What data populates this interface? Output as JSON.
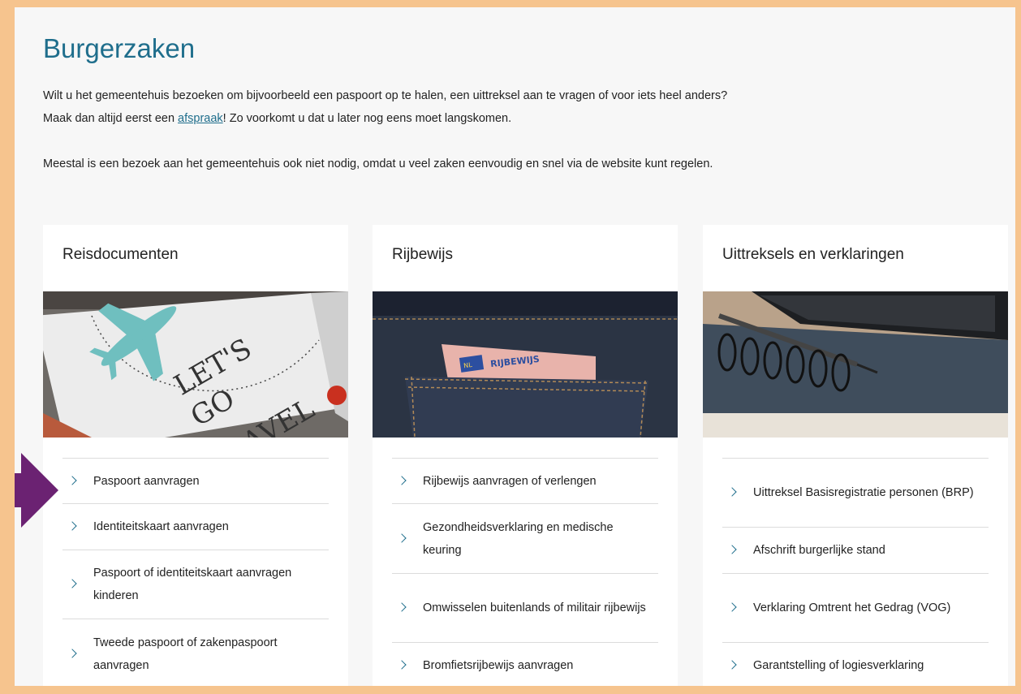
{
  "page": {
    "title": "Burgerzaken",
    "intro": {
      "p1_before": "Wilt u het gemeentehuis bezoeken om bijvoorbeeld een paspoort op te halen, een uittreksel aan te vragen of voor iets heel anders? Maak dan altijd eerst een ",
      "p1_link": "afspraak",
      "p1_after": "! Zo voorkomt u dat u later nog eens moet langskomen.",
      "p2": "Meestal is een bezoek aan het gemeentehuis ook niet nodig, omdat u veel zaken eenvoudig en snel via de website kunt regelen."
    }
  },
  "cards": [
    {
      "title": "Reisdocumenten",
      "image_text": [
        "LET'S",
        "GO",
        "TRAVEL"
      ],
      "links": [
        "Paspoort aanvragen",
        "Identiteitskaart aanvragen",
        "Paspoort of identiteitskaart aanvragen kinderen",
        "Tweede paspoort of zakenpaspoort aanvragen"
      ]
    },
    {
      "title": "Rijbewijs",
      "image_text": [
        "NL",
        "RIJBEWIJS"
      ],
      "links": [
        "Rijbewijs aanvragen of verlengen",
        "Gezondheidsverklaring en medische keuring",
        "Omwisselen buitenlands of militair rijbewijs",
        "Bromfietsrijbewijs aanvragen"
      ]
    },
    {
      "title": "Uittreksels en verklaringen",
      "links": [
        "Uittreksel Basisregistratie personen (BRP)",
        "Afschrift burgerlijke stand",
        "Verklaring Omtrent het Gedrag (VOG)",
        "Garantstelling of logiesverklaring"
      ]
    }
  ],
  "colors": {
    "frame": "#f6c48e",
    "heading": "#1f6e8c",
    "chevron": "#1f6e8c",
    "pointer_arrow": "#6b2272"
  },
  "icons": [
    "chevron-right-icon",
    "arrow-right-icon"
  ]
}
